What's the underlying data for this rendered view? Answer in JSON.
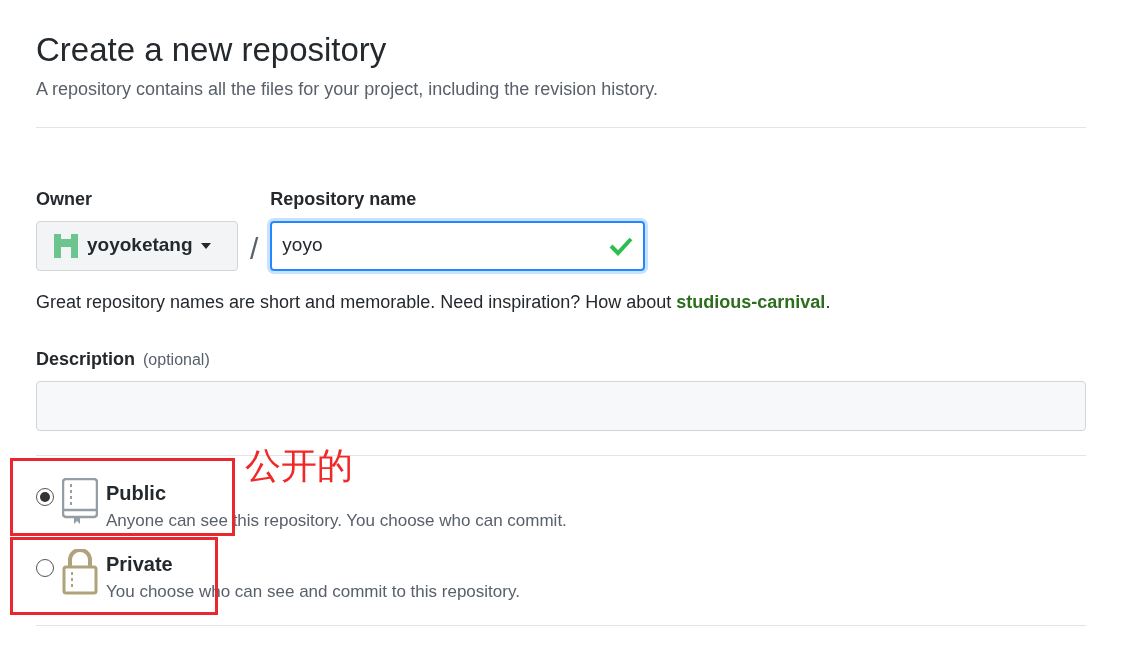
{
  "heading": {
    "title": "Create a new repository",
    "subtitle": "A repository contains all the files for your project, including the revision history."
  },
  "owner": {
    "label": "Owner",
    "value": "yoyoketang"
  },
  "separator": "/",
  "repository_name": {
    "label": "Repository name",
    "value": "yoyo",
    "valid": true
  },
  "name_hint": {
    "text": "Great repository names are short and memorable. Need inspiration? How about ",
    "suggestion": "studious-carnival",
    "end": "."
  },
  "description": {
    "label": "Description",
    "optional": "(optional)"
  },
  "visibility": [
    {
      "kind": "public",
      "title": "Public",
      "text": "Anyone can see this repository. You choose who can commit.",
      "selected": true,
      "highlighted": true
    },
    {
      "kind": "private",
      "title": "Private",
      "text": "You choose who can see and commit to this repository.",
      "selected": false,
      "highlighted": true
    }
  ],
  "annotation": {
    "text": "公开的"
  }
}
